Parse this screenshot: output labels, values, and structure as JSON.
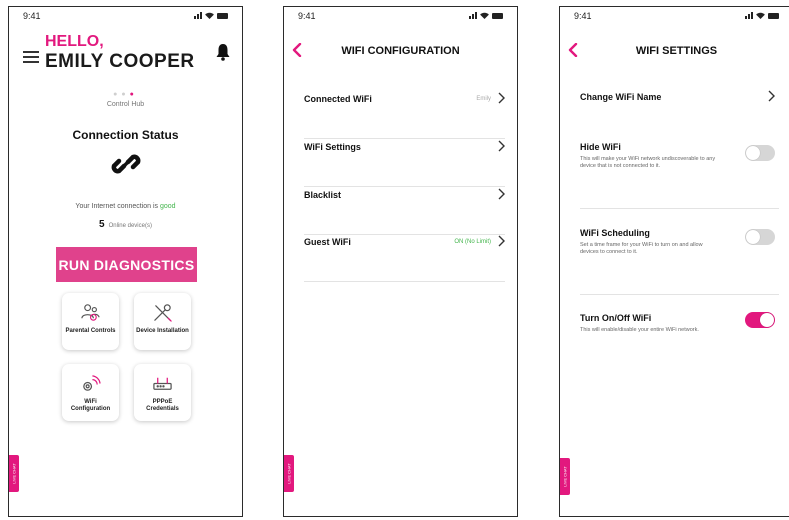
{
  "status_time": "9:41",
  "colors": {
    "accent": "#e2187e",
    "good": "#43b54c",
    "button": "#e0428c"
  },
  "home": {
    "greeting": "HELLO,",
    "user_name": "EMILY COOPER",
    "hub_label": "Control Hub",
    "connection_title": "Connection Status",
    "internet_prefix": "Your Internet connection is ",
    "internet_status": "good",
    "device_count": "5",
    "device_count_label": "Online device(s)",
    "run_button": "RUN DIAGNOSTICS",
    "tiles": [
      {
        "label": "Parental Controls",
        "icon": "parental-controls-icon"
      },
      {
        "label": "Device Installation",
        "icon": "tools-icon"
      },
      {
        "label": "WiFi Configuration",
        "icon": "wifi-gear-icon"
      },
      {
        "label": "PPPoE Credentials",
        "icon": "router-icon"
      }
    ],
    "side_tab": "LIVE CHAT"
  },
  "wifi_config": {
    "title": "WIFI CONFIGURATION",
    "rows": [
      {
        "label": "Connected WiFi",
        "value": "Emily"
      },
      {
        "label": "WiFi Settings",
        "value": ""
      },
      {
        "label": "Blacklist",
        "value": ""
      },
      {
        "label": "Guest WiFi",
        "value": "ON (No Limit)"
      }
    ],
    "side_tab": "LIVE CHAT"
  },
  "wifi_settings": {
    "title": "WIFI SETTINGS",
    "change_name": "Change WiFi Name",
    "settings": [
      {
        "label": "Hide WiFi",
        "desc": "This will make your WiFi network undiscoverable to any device that is not connected to it.",
        "on": false
      },
      {
        "label": "WiFi Scheduling",
        "desc": "Set a time frame for your WiFi to turn on and allow devices to connect to it.",
        "on": false
      },
      {
        "label": "Turn On/Off WiFi",
        "desc": "This will enable/disable your entire WiFi network.",
        "on": true
      }
    ],
    "side_tab": "LIVE CHAT"
  }
}
